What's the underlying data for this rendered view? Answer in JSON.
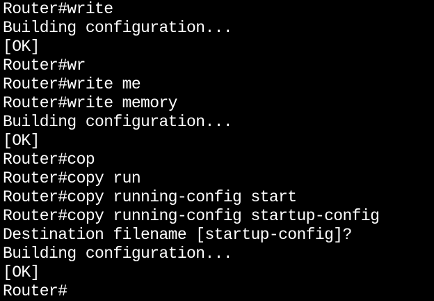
{
  "terminal": {
    "lines": [
      "Router#write",
      "Building configuration...",
      "[OK]",
      "Router#wr",
      "Router#write me",
      "Router#write memory",
      "Building configuration...",
      "[OK]",
      "Router#cop",
      "Router#copy run",
      "Router#copy running-config start",
      "Router#copy running-config startup-config",
      "Destination filename [startup-config]?",
      "Building configuration...",
      "[OK]"
    ],
    "prompt": "Router#"
  },
  "colors": {
    "background": "#000000",
    "text": "#ffffff"
  }
}
